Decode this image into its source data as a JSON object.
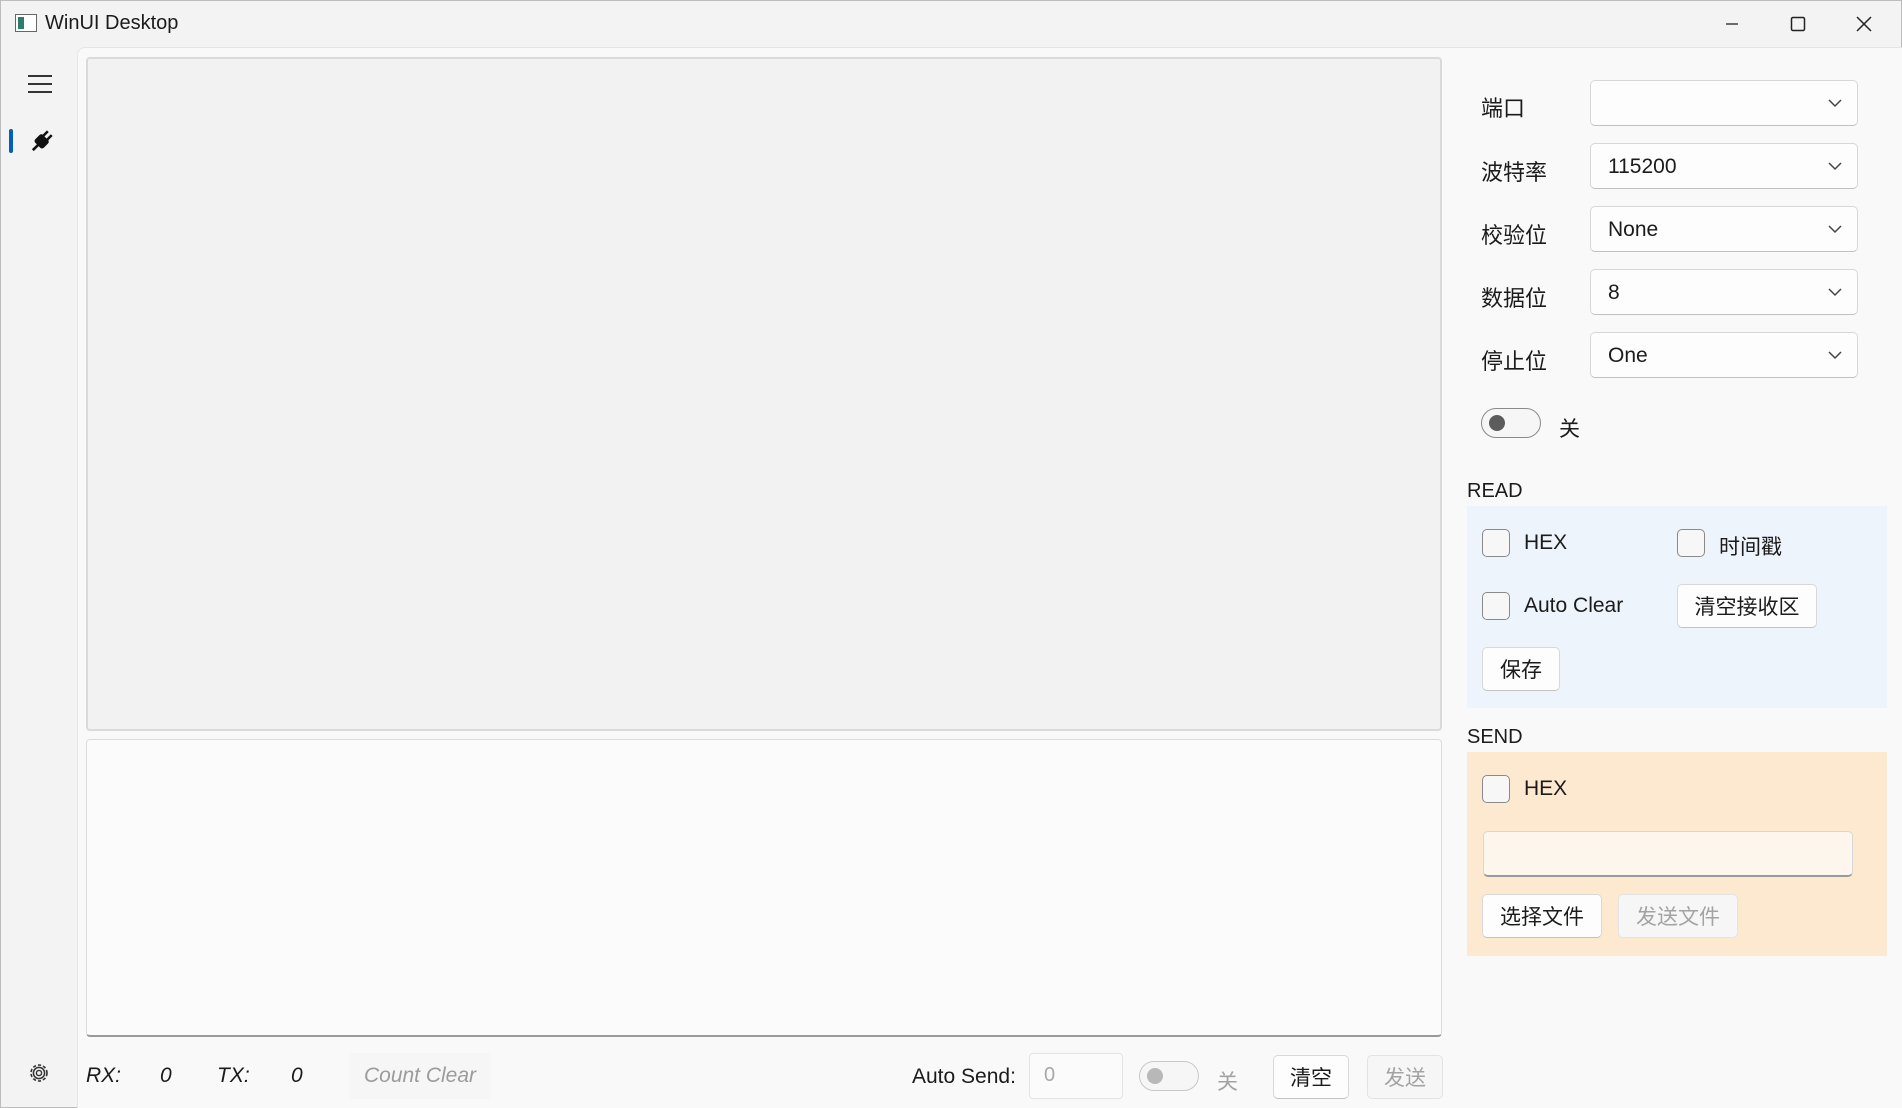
{
  "window": {
    "title": "WinUI Desktop",
    "minimize_icon": "minimize-icon",
    "maximize_icon": "maximize-icon",
    "close_icon": "close-icon"
  },
  "nav": {
    "menu_icon": "hamburger-icon",
    "items": [
      {
        "icon": "plug-icon",
        "selected": true
      }
    ],
    "settings_icon": "gear-icon",
    "accent": "#005fb8"
  },
  "settings": {
    "port_label": "端口",
    "port_value": "",
    "baud_label": "波特率",
    "baud_value": "115200",
    "parity_label": "校验位",
    "parity_value": "None",
    "databits_label": "数据位",
    "databits_value": "8",
    "stopbits_label": "停止位",
    "stopbits_value": "One",
    "connect_toggle_label": "关"
  },
  "read": {
    "title": "READ",
    "hex_label": "HEX",
    "timestamp_label": "时间戳",
    "auto_clear_label": "Auto Clear",
    "clear_receive_button": "清空接收区",
    "save_button": "保存",
    "bg_color": "#eef4fb"
  },
  "send": {
    "title": "SEND",
    "hex_label": "HEX",
    "input_value": "",
    "choose_file_button": "选择文件",
    "send_file_button": "发送文件",
    "bg_color": "#fde9cf"
  },
  "status": {
    "rx_label": "RX:",
    "rx_value": "0",
    "tx_label": "TX:",
    "tx_value": "0",
    "count_clear_button": "Count Clear",
    "auto_send_label": "Auto Send:",
    "auto_send_interval": "0",
    "auto_send_toggle_label": "关",
    "clear_button": "清空",
    "send_button": "发送"
  }
}
